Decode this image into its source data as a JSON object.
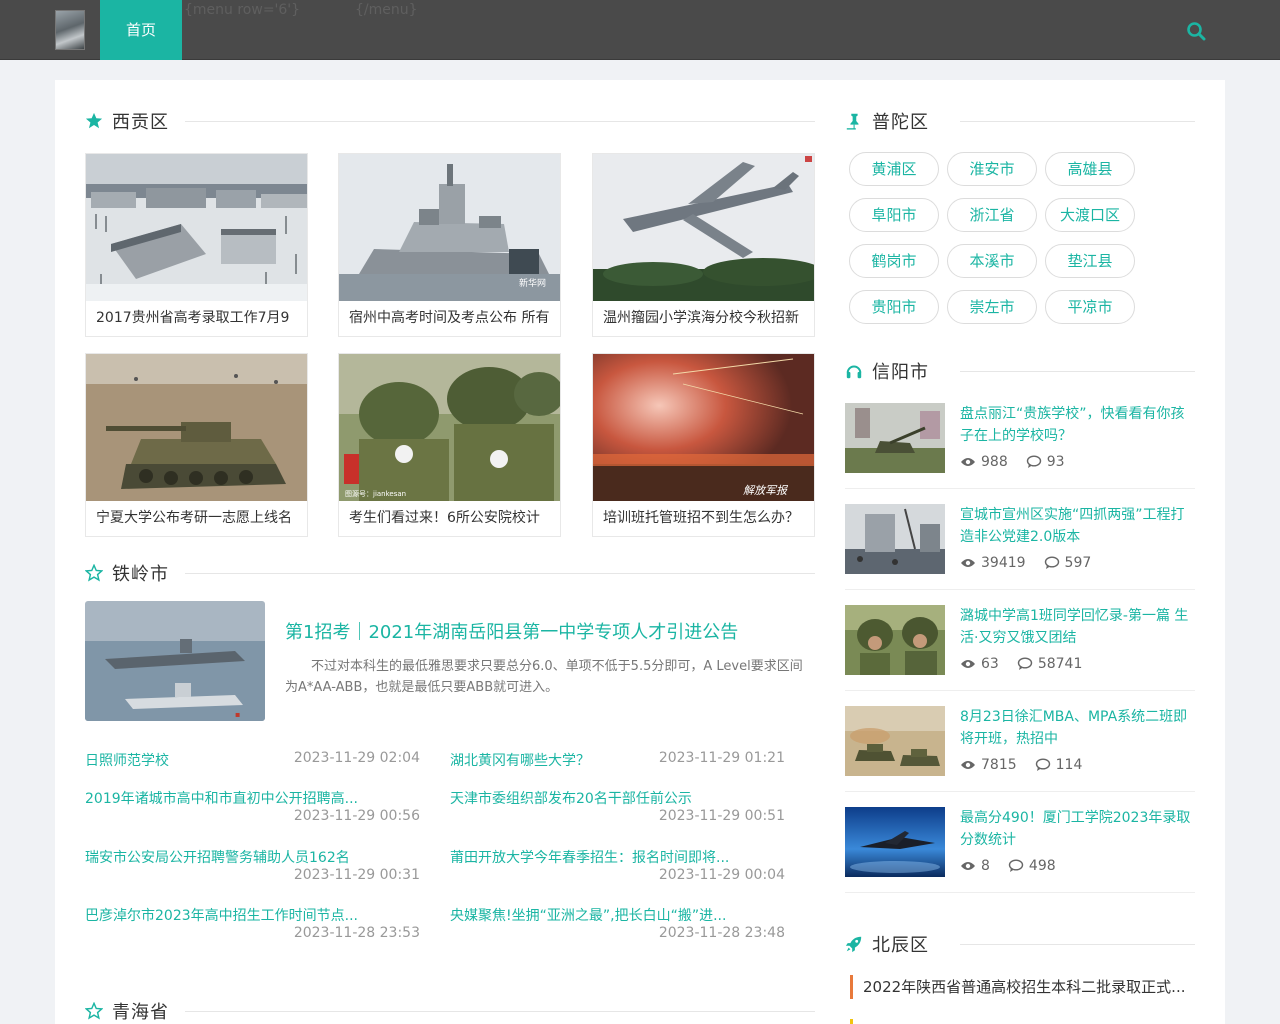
{
  "header": {
    "nav_home": "首页",
    "template_open": "{menu row='6'}",
    "template_close": "{/menu}",
    "accent": "#1bb5a3"
  },
  "section_xigong": {
    "title": "西贡区",
    "icon": "star-solid-icon",
    "cards": [
      {
        "caption": "2017贵州省高考录取工作7月9",
        "scene": "snowy-city"
      },
      {
        "caption": "宿州中高考时间及考点公布 所有",
        "scene": "warship",
        "watermark": "新华网"
      },
      {
        "caption": "温州籀园小学滨海分校今秋招新",
        "scene": "aircraft"
      },
      {
        "caption": "宁夏大学公布考研一志愿上线名",
        "scene": "tank"
      },
      {
        "caption": "考生们看过来！6所公安院校计",
        "scene": "soldiers",
        "watermark": "图源号：jiankesan"
      },
      {
        "caption": "培训班托管班招不到生怎么办？",
        "scene": "explosion",
        "watermark": "解放军报"
      }
    ]
  },
  "section_tieling": {
    "title": "铁岭市",
    "icon": "star-outline-icon",
    "featured": {
      "title": "第1招考｜2021年湖南岳阳县第一中学专项人才引进公告",
      "desc": "不过对本科生的最低雅思要求只要总分6.0、单项不低于5.5分即可，A Level要求区间为A*AA-ABB，也就是最低只要ABB就可进入。"
    },
    "news": [
      {
        "title": "日照师范学校",
        "date": "2023-11-29 02:04"
      },
      {
        "title": "湖北黄冈有哪些大学？",
        "date": "2023-11-29 01:21"
      },
      {
        "title": "2019年诸城市高中和市直初中公开招聘高...",
        "date": "2023-11-29 00:56"
      },
      {
        "title": "天津市委组织部发布20名干部任前公示",
        "date": "2023-11-29 00:51"
      },
      {
        "title": "瑞安市公安局公开招聘警务辅助人员162名",
        "date": "2023-11-29 00:31"
      },
      {
        "title": "莆田开放大学今年春季招生：报名时间即将...",
        "date": "2023-11-29 00:04"
      },
      {
        "title": "巴彦淖尔市2023年高中招生工作时间节点...",
        "date": "2023-11-28 23:53"
      },
      {
        "title": "央媒聚焦!坐拥“亚洲之最”,把长白山“搬”进...",
        "date": "2023-11-28 23:48"
      }
    ]
  },
  "section_qinghai": {
    "title": "青海省",
    "icon": "star-outline-icon"
  },
  "sidebar": {
    "putuo": {
      "title": "普陀区",
      "icon": "thumbtack-icon",
      "tags": [
        "黄浦区",
        "淮安市",
        "高雄县",
        "阜阳市",
        "浙江省",
        "大渡口区",
        "鹤岗市",
        "本溪市",
        "垫江县",
        "贵阳市",
        "崇左市",
        "平凉市"
      ]
    },
    "xinyang": {
      "title": "信阳市",
      "icon": "headphones-icon",
      "items": [
        {
          "title": "盘点丽江“贵族学校”，快看看有你孩子在上的学校吗？",
          "views": "988",
          "comments": "93",
          "scene": "field-gun"
        },
        {
          "title": "宣城市宣州区实施“四抓两强”工程打造非公党建2.0版本",
          "views": "39419",
          "comments": "597",
          "scene": "ship-deck"
        },
        {
          "title": "潞城中学高1班同学回忆录-第一篇 生活·又穷又饿又团结",
          "views": "63",
          "comments": "58741",
          "scene": "soldiers"
        },
        {
          "title": "8月23日徐汇MBA、MPA系统二班即将开班，热招中",
          "views": "7815",
          "comments": "114",
          "scene": "tanks"
        },
        {
          "title": "最高分490！厦门工学院2023年录取分数统计",
          "views": "8",
          "comments": "498",
          "scene": "stealth-jet"
        }
      ]
    },
    "beichen": {
      "title": "北辰区",
      "icon": "rocket-icon",
      "items": [
        {
          "title": "2022年陕西省普通高校招生本科二批录取正式...",
          "bar_color": "#e8793b"
        }
      ]
    }
  }
}
